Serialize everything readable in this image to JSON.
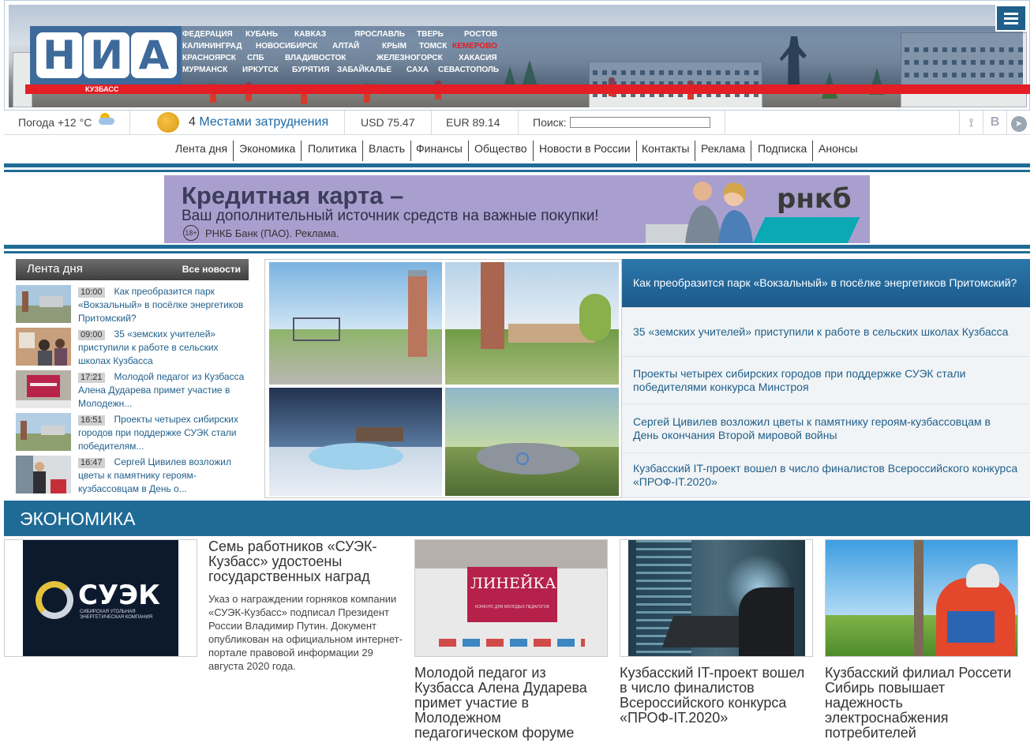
{
  "header": {
    "logo_letters": [
      "Н",
      "И",
      "А"
    ],
    "region_label": "КУЗБАСС",
    "cities": [
      {
        "label": "ФЕДЕРАЦИЯ"
      },
      {
        "label": "КУБАНЬ"
      },
      {
        "label": "КАВКАЗ"
      },
      {
        "label": "ЯРОСЛАВЛЬ"
      },
      {
        "label": "ТВЕРЬ"
      },
      {
        "label": "РОСТОВ"
      },
      {
        "label": "КАЛИНИНГРАД"
      },
      {
        "label": "НОВОСИБИРСК"
      },
      {
        "label": "АЛТАЙ"
      },
      {
        "label": "КРЫМ"
      },
      {
        "label": "ТОМСК"
      },
      {
        "label": "КЕМЕРОВО",
        "active": true
      },
      {
        "label": "КРАСНОЯРСК"
      },
      {
        "label": "СПБ"
      },
      {
        "label": "ВЛАДИВОСТОК"
      },
      {
        "label": "ЖЕЛЕЗНОГОРСК"
      },
      {
        "label": "ХАКАСИЯ"
      },
      {
        "label": "МУРМАНСК"
      },
      {
        "label": "ИРКУТСК"
      },
      {
        "label": "БУРЯТИЯ"
      },
      {
        "label": "ЗАБАЙКАЛЬЕ"
      },
      {
        "label": "САХА"
      },
      {
        "label": "СЕВАСТОПОЛЬ"
      }
    ],
    "menu_icon": "hamburger-icon"
  },
  "info_bar": {
    "weather": "Погода +12 °C",
    "weather_icon": "partly-cloudy-icon",
    "traffic_count": "4",
    "traffic_label": "Местами затруднения",
    "usd": "USD 75.47",
    "eur": "EUR 89.14",
    "search_label": "Поиск:",
    "search_value": "",
    "social": [
      "rss-icon",
      "vk-icon",
      "telegram-icon"
    ]
  },
  "nav": [
    "Лента дня",
    "Экономика",
    "Политика",
    "Власть",
    "Финансы",
    "Общество",
    "Новости в России",
    "Контакты",
    "Реклама",
    "Подписка",
    "Анонсы"
  ],
  "ad": {
    "title": "Кредитная карта –",
    "subtitle": "Ваш дополнительный источник средств на важные покупки!",
    "age": "18+",
    "legal": "РНКБ Банк (ПАО). Реклама.",
    "brand": "рнкб",
    "accent": "#0aa9b4"
  },
  "feed": {
    "title": "Лента дня",
    "all_link": "Все новости",
    "items": [
      {
        "time": "10:00",
        "text": "Как преобразится парк «Вокзальный» в посёлке энергетиков Притомский?"
      },
      {
        "time": "09:00",
        "text": "35 «земских учителей» приступили к работе в сельских школах Кузбасса"
      },
      {
        "time": "17:21",
        "text": "Молодой педагог из Кузбасса Алена Дударева примет участие в Молодежн..."
      },
      {
        "time": "16:51",
        "text": "Проекты четырех сибирских городов при поддержке СУЭК стали победителям..."
      },
      {
        "time": "16:47",
        "text": "Сергей Цивилев возложил цветы к памятнику героям-кузбассовцам в День о..."
      }
    ]
  },
  "headlines": [
    {
      "text": "Как преобразится парк «Вокзальный» в посёлке энергетиков Притомский?",
      "active": true
    },
    {
      "text": "35 «земских учителей» приступили к работе в сельских школах Кузбасса"
    },
    {
      "text": "Проекты четырех сибирских городов при поддержке СУЭК стали победителями конкурса Минстроя"
    },
    {
      "text": "Сергей Цивилев возложил цветы к памятнику героям-кузбассовцам в День окончания Второй мировой войны"
    },
    {
      "text": "Кузбасский IT-проект вошел в число финалистов Всероссийского конкурса «ПРОФ-IT.2020»"
    }
  ],
  "economy": {
    "section_title": "ЭКОНОМИКА",
    "lead": {
      "logo_text": "СУЭК",
      "logo_sub1": "СИБИРСКАЯ УГОЛЬНАЯ",
      "logo_sub2": "ЭНЕРГЕТИЧЕСКАЯ КОМПАНИЯ",
      "title": "Семь работников «СУЭК-Кузбасс» удостоены государственных наград",
      "text": "Указ о награждении горняков компании «СУЭК-Кузбасс» подписал Президент России Владимир Путин. Документ опубликован на официальном интернет-портале правовой информации 29 августа 2020 года."
    },
    "cards": [
      {
        "title": "Молодой педагог из Кузбасса Алена Дударева примет участие в Молодежном педагогическом форуме",
        "poster_title": "ЛИНЕЙКА",
        "poster_sub": "КОНКУРС ДЛЯ МОЛОДЫХ ПЕДАГОГОВ"
      },
      {
        "title": "Кузбасский IT-проект вошел в число финалистов Всероссийского конкурса «ПРОФ-IT.2020»"
      },
      {
        "title": "Кузбасский филиал Россети Сибирь повышает надежность электроснабжения потребителей"
      }
    ]
  }
}
